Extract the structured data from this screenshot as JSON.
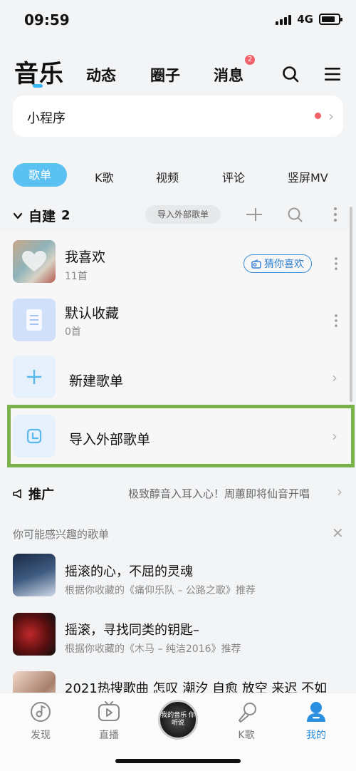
{
  "status": {
    "time": "09:59",
    "network": "4G"
  },
  "header": {
    "tabs": [
      {
        "label": "音乐"
      },
      {
        "label": "动态"
      },
      {
        "label": "圈子"
      },
      {
        "label": "消息"
      }
    ],
    "message_badge": "2"
  },
  "mini_program": {
    "label": "小程序"
  },
  "subtabs": [
    "歌单",
    "K歌",
    "视频",
    "评论",
    "竖屏MV"
  ],
  "self_built": {
    "title": "自建",
    "count": "2",
    "import_chip": "导入外部歌单"
  },
  "playlists": [
    {
      "title": "我喜欢",
      "subtitle": "11首"
    },
    {
      "title": "默认收藏",
      "subtitle": "0首"
    }
  ],
  "guess_button": "猜你喜欢",
  "actions": {
    "new_playlist": "新建歌单",
    "import_playlist": "导入外部歌单"
  },
  "promo": {
    "title": "推广",
    "text": "极致醇音入耳入心！周蕙即将仙音开唱"
  },
  "recommend": {
    "label": "你可能感兴趣的歌单",
    "items": [
      {
        "title": "摇滚的心，不屈的灵魂",
        "subtitle": "根据你收藏的《痛仰乐队 – 公路之歌》推荐"
      },
      {
        "title": "摇滚，寻找同类的钥匙–",
        "subtitle": "根据你收藏的《木马 – 纯洁2016》推荐"
      },
      {
        "title": "2021热搜歌曲 怎叹 潮汐 自愈 放空 来迟 不如"
      }
    ]
  },
  "bottom_nav": {
    "items": [
      {
        "label": "发现"
      },
      {
        "label": "直播"
      },
      {
        "label": "K歌"
      },
      {
        "label": "我的"
      }
    ],
    "center_text": "我的音乐 你听说"
  },
  "colors": {
    "accent": "#5bc0f2",
    "badge": "#f0616a",
    "highlight": "#79b249",
    "active_nav": "#2b8fe0"
  }
}
